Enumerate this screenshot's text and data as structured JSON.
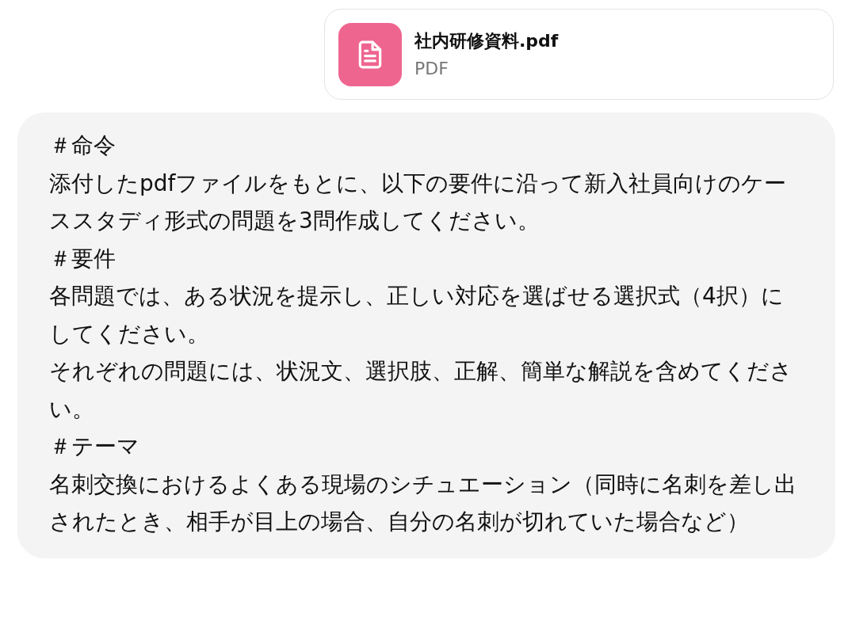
{
  "attachment": {
    "name": "社内研修資料.pdf",
    "type": "PDF"
  },
  "message": {
    "paragraphs": [
      "＃命令",
      "添付したpdfファイルをもとに、以下の要件に沿って新入社員向けのケーススタディ形式の問題を3問作成してください。",
      "＃要件",
      "各問題では、ある状況を提示し、正しい対応を選ばせる選択式（4択）にしてください。",
      "それぞれの問題には、状況文、選択肢、正解、簡単な解説を含めてください。",
      "＃テーマ",
      "名刺交換におけるよくある現場のシチュエーション（同時に名刺を差し出されたとき、相手が目上の場合、自分の名刺が切れていた場合など）"
    ]
  }
}
